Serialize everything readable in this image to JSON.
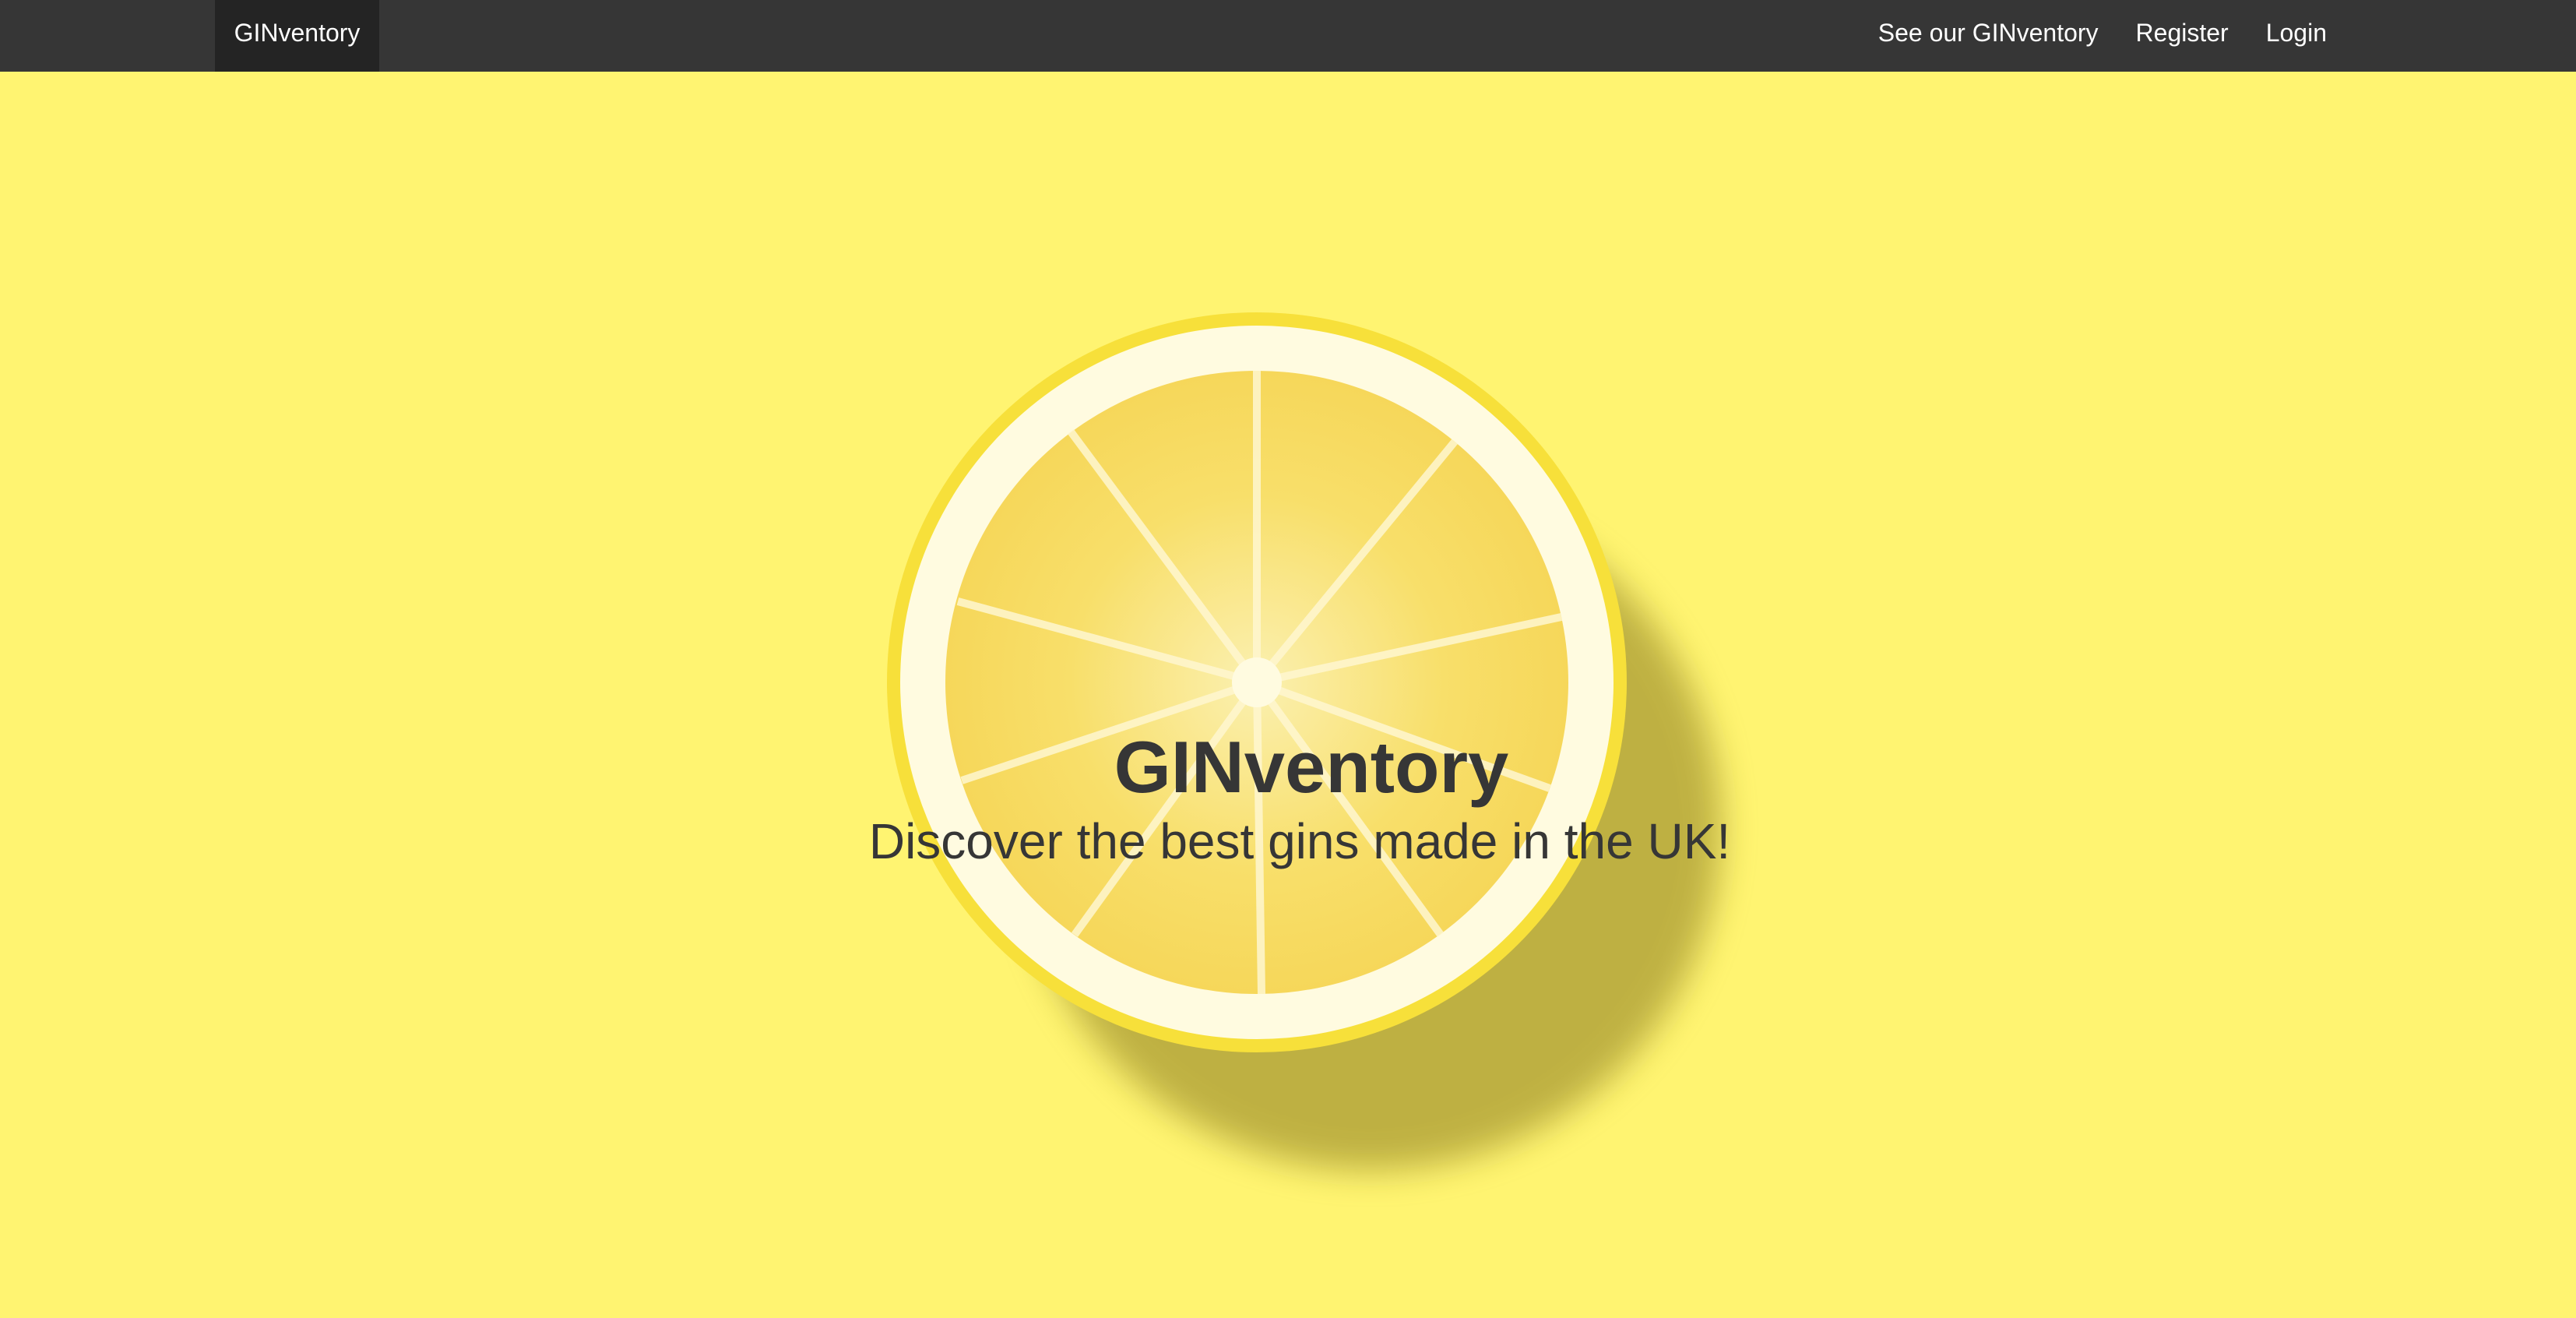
{
  "navbar": {
    "brand": "GINventory",
    "links": [
      "See our GINventory",
      "Register",
      "Login"
    ]
  },
  "hero": {
    "title": "GINventory",
    "subtitle": "Discover the best gins made in the UK!"
  },
  "colors": {
    "navbar": "#363636",
    "brand_bg": "#242424",
    "background": "#fff471",
    "text": "#363636"
  }
}
